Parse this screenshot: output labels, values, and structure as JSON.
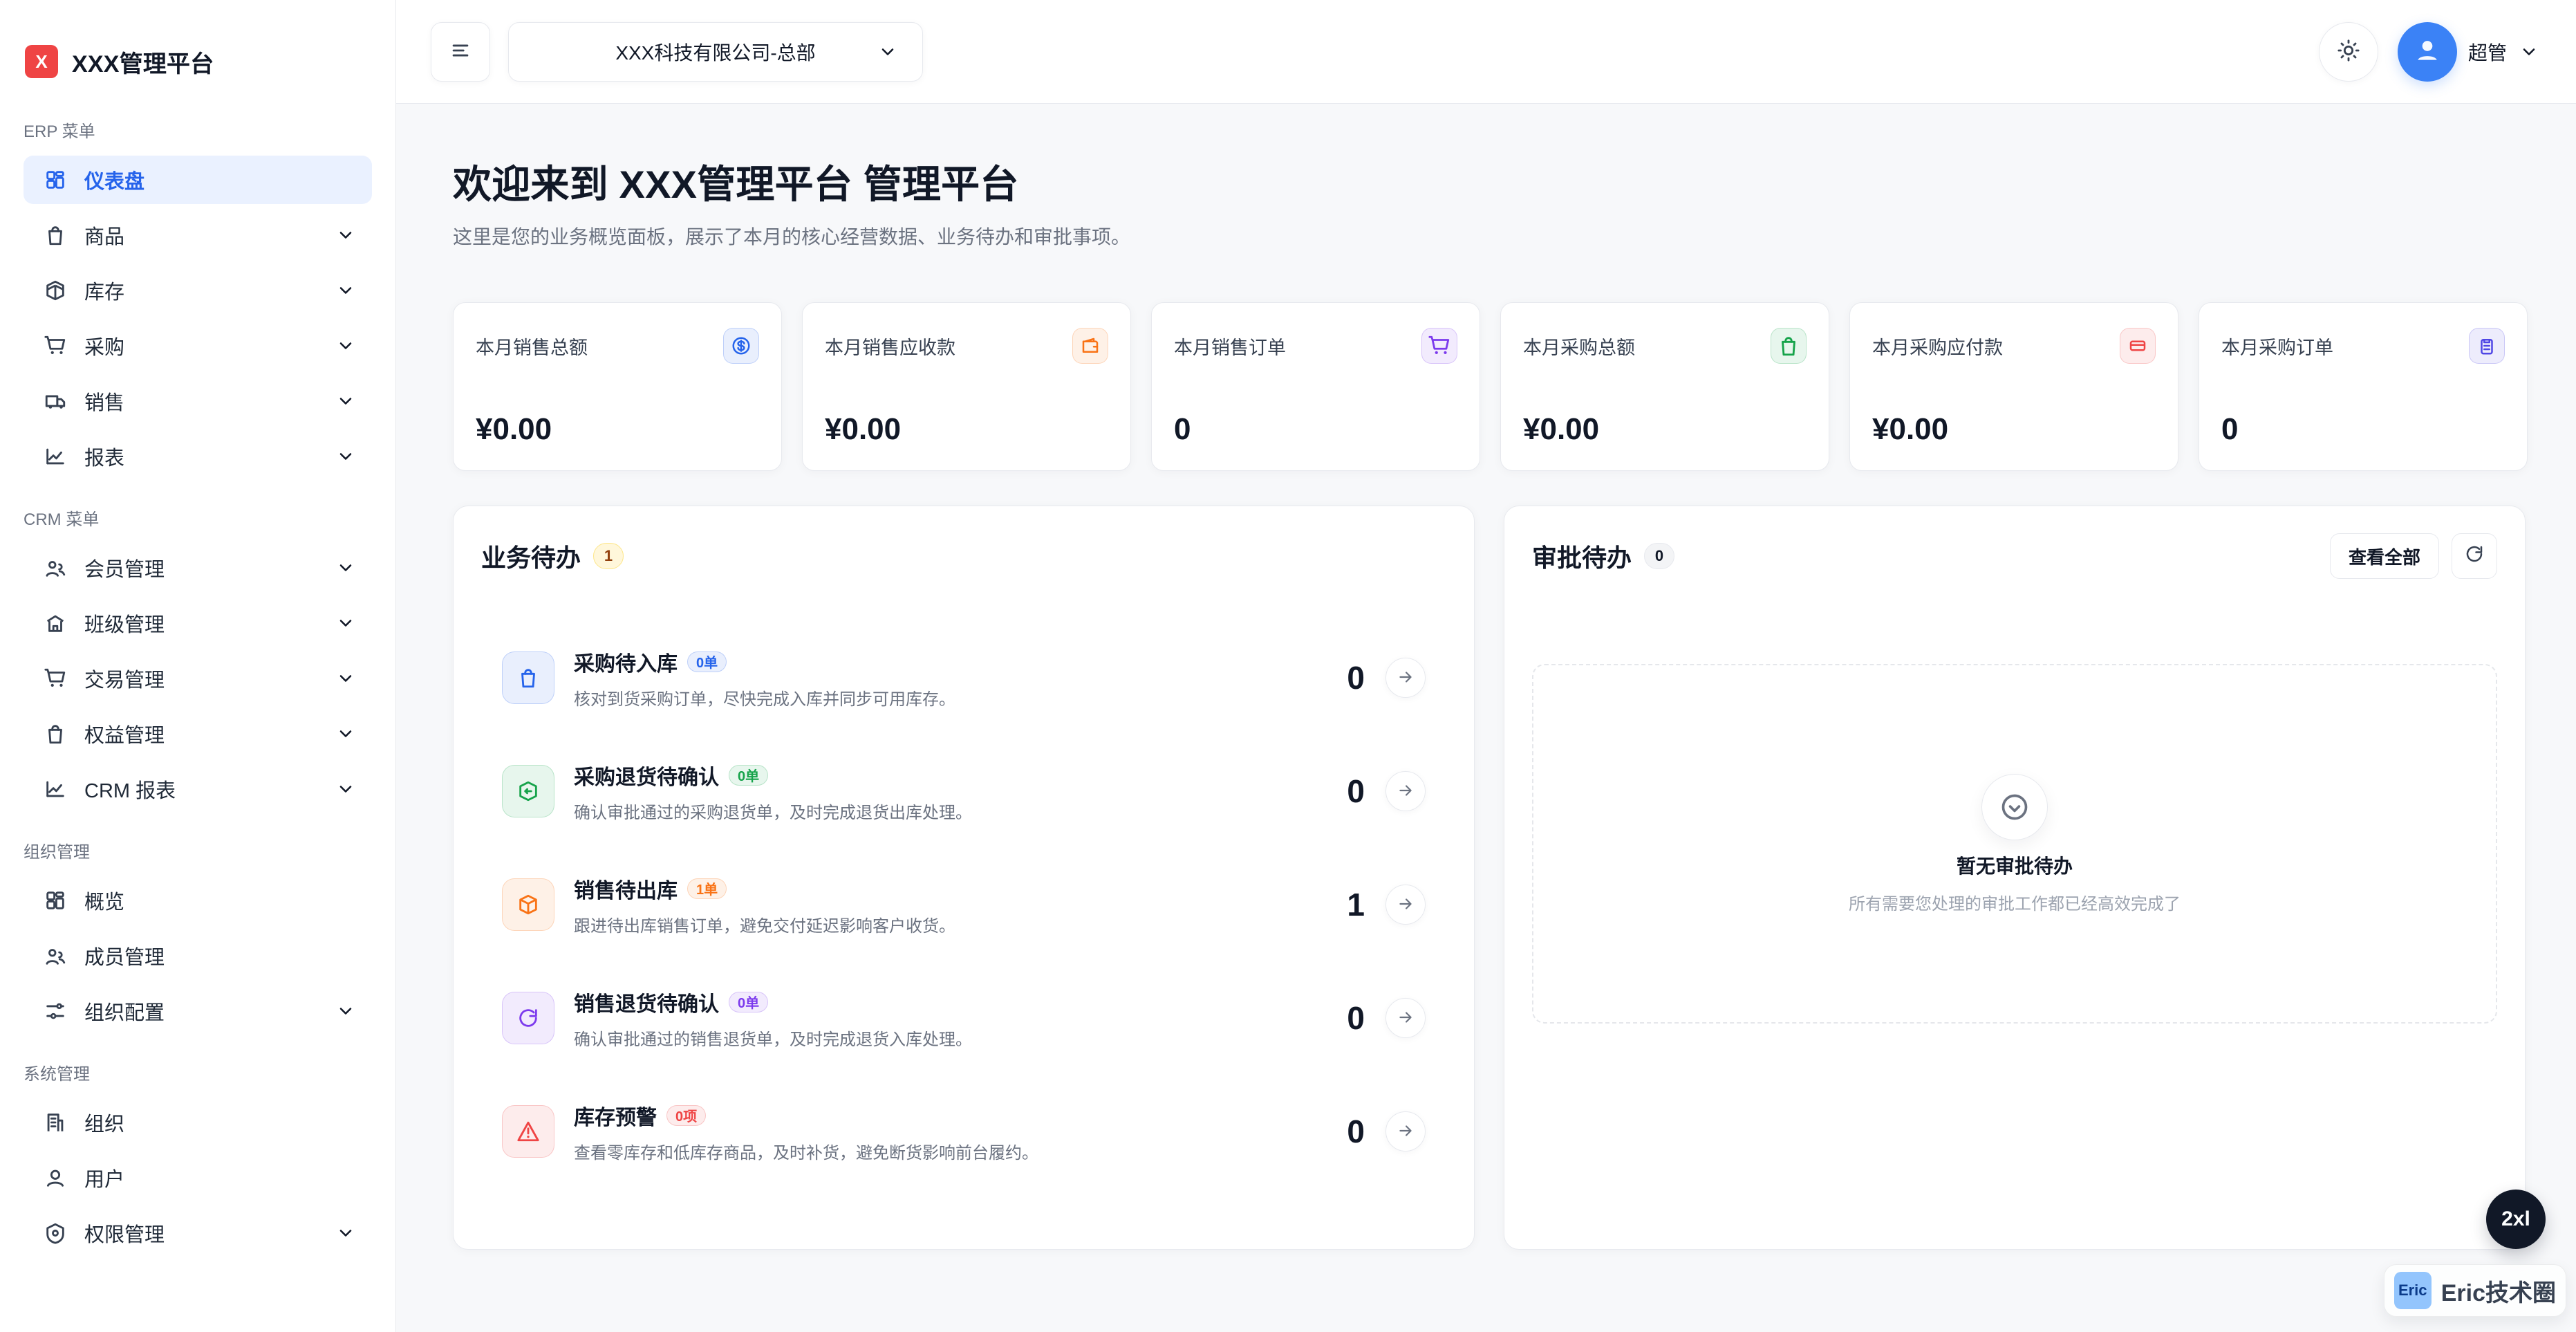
{
  "app": {
    "brand": "XXX管理平台",
    "brand_logo_text": "X"
  },
  "sidebar": {
    "sections": [
      {
        "title": "ERP 菜单",
        "items": [
          {
            "label": "仪表盘",
            "icon": "dashboard-icon",
            "active": true,
            "has_chevron": false
          },
          {
            "label": "商品",
            "icon": "bag-icon",
            "active": false,
            "has_chevron": true
          },
          {
            "label": "库存",
            "icon": "cube-icon",
            "active": false,
            "has_chevron": true
          },
          {
            "label": "采购",
            "icon": "cart-icon",
            "active": false,
            "has_chevron": true
          },
          {
            "label": "销售",
            "icon": "truck-icon",
            "active": false,
            "has_chevron": true
          },
          {
            "label": "报表",
            "icon": "line-chart-icon",
            "active": false,
            "has_chevron": true
          }
        ]
      },
      {
        "title": "CRM 菜单",
        "items": [
          {
            "label": "会员管理",
            "icon": "user-group-icon",
            "active": false,
            "has_chevron": true
          },
          {
            "label": "班级管理",
            "icon": "school-icon",
            "active": false,
            "has_chevron": true
          },
          {
            "label": "交易管理",
            "icon": "cart-icon",
            "active": false,
            "has_chevron": true
          },
          {
            "label": "权益管理",
            "icon": "bag-icon",
            "active": false,
            "has_chevron": true
          },
          {
            "label": "CRM 报表",
            "icon": "line-chart-icon",
            "active": false,
            "has_chevron": true
          }
        ]
      },
      {
        "title": "组织管理",
        "items": [
          {
            "label": "概览",
            "icon": "dashboard-icon",
            "active": false,
            "has_chevron": false
          },
          {
            "label": "成员管理",
            "icon": "user-group-icon",
            "active": false,
            "has_chevron": false
          },
          {
            "label": "组织配置",
            "icon": "sliders-icon",
            "active": false,
            "has_chevron": true
          }
        ]
      },
      {
        "title": "系统管理",
        "items": [
          {
            "label": "组织",
            "icon": "building-icon",
            "active": false,
            "has_chevron": false
          },
          {
            "label": "用户",
            "icon": "user-icon",
            "active": false,
            "has_chevron": false
          },
          {
            "label": "权限管理",
            "icon": "shield-icon",
            "active": false,
            "has_chevron": true
          }
        ]
      }
    ]
  },
  "topbar": {
    "company": "XXX科技有限公司-总部",
    "user_name": "超管"
  },
  "page": {
    "title": "欢迎来到 XXX管理平台 管理平台",
    "subtitle": "这里是您的业务概览面板，展示了本月的核心经营数据、业务待办和审批事项。"
  },
  "stats": [
    {
      "label": "本月销售总额",
      "value": "¥0.00",
      "icon": "dollar-icon",
      "tone": "blue"
    },
    {
      "label": "本月销售应收款",
      "value": "¥0.00",
      "icon": "wallet-icon",
      "tone": "orange"
    },
    {
      "label": "本月销售订单",
      "value": "0",
      "icon": "cart-icon",
      "tone": "purple"
    },
    {
      "label": "本月采购总额",
      "value": "¥0.00",
      "icon": "bag-icon",
      "tone": "green"
    },
    {
      "label": "本月采购应付款",
      "value": "¥0.00",
      "icon": "card-icon",
      "tone": "red"
    },
    {
      "label": "本月采购订单",
      "value": "0",
      "icon": "clipboard-icon",
      "tone": "indigo"
    }
  ],
  "todo_panel": {
    "title": "业务待办",
    "count": "1",
    "items": [
      {
        "title": "采购待入库",
        "badge": "0单",
        "desc": "核对到货采购订单，尽快完成入库并同步可用库存。",
        "count": "0",
        "icon": "bag-icon",
        "tone": "blue"
      },
      {
        "title": "采购退货待确认",
        "badge": "0单",
        "desc": "确认审批通过的采购退货单，及时完成退货出库处理。",
        "count": "0",
        "icon": "box-return-icon",
        "tone": "green"
      },
      {
        "title": "销售待出库",
        "badge": "1单",
        "desc": "跟进待出库销售订单，避免交付延迟影响客户收货。",
        "count": "1",
        "icon": "package-icon",
        "tone": "orange"
      },
      {
        "title": "销售退货待确认",
        "badge": "0单",
        "desc": "确认审批通过的销售退货单，及时完成退货入库处理。",
        "count": "0",
        "icon": "rotate-icon",
        "tone": "purple"
      },
      {
        "title": "库存预警",
        "badge": "0项",
        "desc": "查看零库存和低库存商品，及时补货，避免断货影响前台履约。",
        "count": "0",
        "icon": "warning-icon",
        "tone": "red"
      }
    ]
  },
  "approval_panel": {
    "title": "审批待办",
    "count": "0",
    "view_all": "查看全部",
    "empty_title": "暂无审批待办",
    "empty_sub": "所有需要您处理的审批工作都已经高效完成了"
  },
  "watermark": {
    "logo_text": "Eric",
    "text": "Eric技术圈"
  },
  "floating": {
    "zoom": "2xl"
  },
  "colors": {
    "accent": "#2563eb",
    "blue": "#2563eb",
    "orange": "#f97316",
    "purple": "#7c3aed",
    "green": "#16a34a",
    "red": "#ef4444",
    "indigo": "#4f46e5"
  }
}
